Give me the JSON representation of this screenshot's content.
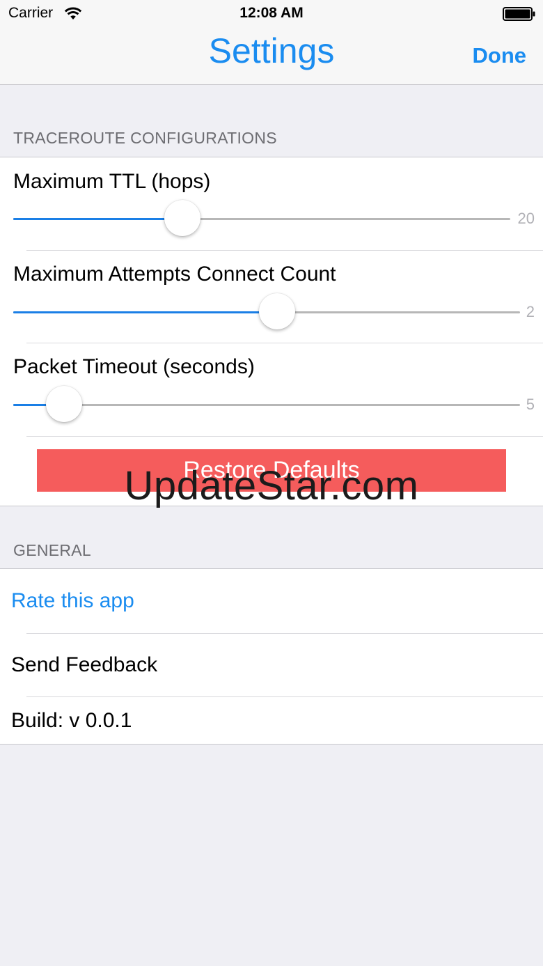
{
  "status_bar": {
    "carrier": "Carrier",
    "time": "12:08 AM"
  },
  "nav": {
    "title": "Settings",
    "done_label": "Done"
  },
  "traceroute_section": {
    "header": "TRACEROUTE CONFIGURATIONS",
    "sliders": [
      {
        "label": "Maximum TTL (hops)",
        "max_label": "20",
        "level": 0.34
      },
      {
        "label": "Maximum Attempts Connect Count",
        "max_label": "2",
        "level": 0.52
      },
      {
        "label": "Packet Timeout (seconds)",
        "max_label": "5",
        "level": 0.1
      }
    ],
    "restore_label": "Restore Defaults"
  },
  "general_section": {
    "header": "GENERAL",
    "rate_label": "Rate this app",
    "feedback_label": "Send Feedback",
    "build_label": "Build: v 0.0.1"
  },
  "watermark": "UpdateStar.com",
  "colors": {
    "accent": "#1a8cf0",
    "slider_fill": "#1a7fe6",
    "destructive": "#f55c5c",
    "background": "#efeff4"
  }
}
